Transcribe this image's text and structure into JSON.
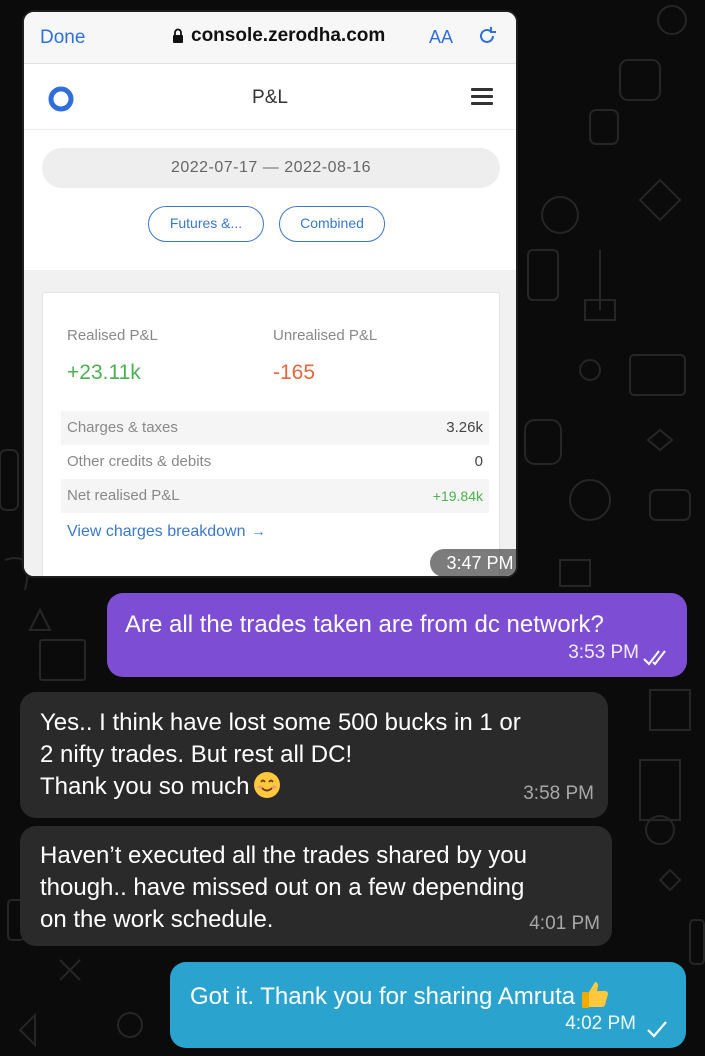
{
  "browser": {
    "done_label": "Done",
    "url": "console.zerodha.com",
    "text_size_label": "AA"
  },
  "app": {
    "title": "P&L",
    "date_range": "2022-07-17  —  2022-08-16",
    "segment_futures": "Futures &...",
    "segment_combined": "Combined"
  },
  "pnl": {
    "realised_label": "Realised P&L",
    "realised_value": "+23.11k",
    "unrealised_label": "Unrealised P&L",
    "unrealised_value": "-165",
    "rows": [
      {
        "label": "Charges & taxes",
        "value": "3.26k"
      },
      {
        "label": "Other credits & debits",
        "value": "0"
      },
      {
        "label": "Net realised P&L",
        "value": "+19.84k"
      }
    ],
    "charges_link": "View charges breakdown",
    "colors": {
      "profit": "#4caf50",
      "loss": "#e2683c",
      "link": "#3a78c9"
    }
  },
  "chat": {
    "image_time": "3:47 PM",
    "messages": [
      {
        "direction": "outgoing",
        "text": "Are all the trades taken are from dc network?",
        "time": "3:53 PM",
        "status": "read-double-tick"
      },
      {
        "direction": "incoming",
        "lines": [
          "Yes.. I think have lost some 500 bucks in 1 or",
          "2 nifty trades. But rest all DC!",
          "Thank you so much"
        ],
        "emoji": "smiling-face",
        "time": "3:58 PM"
      },
      {
        "direction": "incoming",
        "lines": [
          "Haven’t executed all the trades shared by you",
          "though.. have missed out on a few depending",
          "on the work schedule."
        ],
        "time": "4:01 PM"
      },
      {
        "direction": "outgoing",
        "text": "Got it. Thank you for sharing Amruta",
        "emoji": "thumbs-up",
        "time": "4:02 PM",
        "status": "sent-single-tick"
      }
    ],
    "colors": {
      "outgoing_purple": "#7d4ed3",
      "incoming": "#2a2a2a",
      "outgoing_teal": "#2aa4cf"
    }
  }
}
